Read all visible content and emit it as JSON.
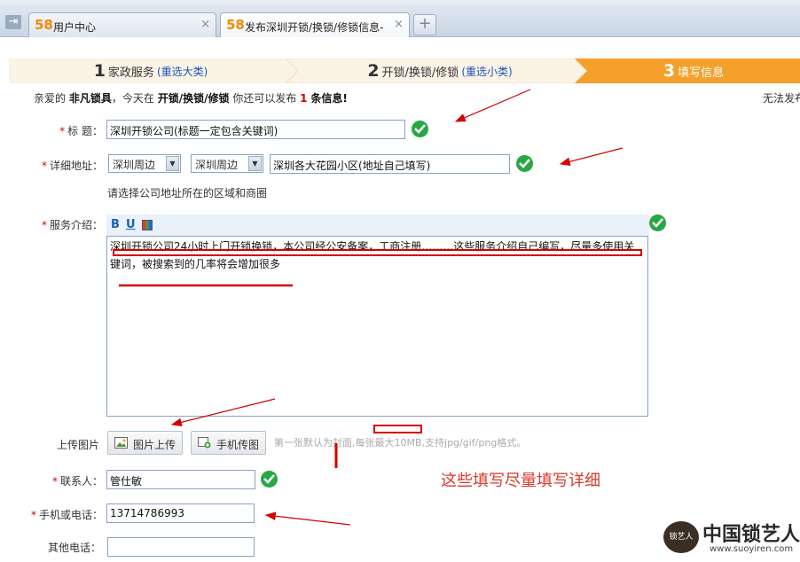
{
  "browser": {
    "tabs": [
      {
        "logo": "58",
        "title": "用户中心",
        "active": false
      },
      {
        "logo": "58",
        "title": "发布深圳开锁/换锁/修锁信息-",
        "active": true
      }
    ],
    "new_tab": "+",
    "close": "×"
  },
  "steps": [
    {
      "number": "1",
      "label": "家政服务",
      "link": "(重选大类)"
    },
    {
      "number": "2",
      "label": "开锁/换锁/修锁",
      "link": "(重选小类)"
    },
    {
      "number": "3",
      "label": "填写信息",
      "link": ""
    }
  ],
  "intro": {
    "prefix": "亲爱的",
    "user": "非凡锁具",
    "middle": "，今天在",
    "category": "开锁/换锁/修锁",
    "suffix_a": "你还可以发布",
    "count": "1",
    "suffix_b": "条信息!",
    "right": "无法发布"
  },
  "form": {
    "required_mark": "*",
    "title": {
      "label": "标  题：",
      "value": "深圳开锁公司(标题一定包含关键词)"
    },
    "address": {
      "label": "详细地址：",
      "select1": "深圳周边",
      "select2": "深圳周边",
      "value": "深圳各大花园小区(地址自己填写)",
      "hint": "请选择公司地址所在的区域和商圈"
    },
    "service": {
      "label": "服务介绍：",
      "toolbar": {
        "bold": "B",
        "underline": "U"
      },
      "content": "深圳开锁公司24小时上门开锁换锁，本公司经公安备案，工商注册………这些服务介绍自己编写，尽量多使用关键词，被搜索到的几率将会增加很多"
    },
    "upload": {
      "label": "上传图片",
      "upload_button": "图片上传",
      "phone_button": "手机传图",
      "hint": "第一张默认为封面,每张最大10MB,支持jpg/gif/png格式。"
    },
    "contact": {
      "label": "联系人：",
      "value": "管仕敏"
    },
    "phone": {
      "label": "手机或电话：",
      "value": "13714786993"
    },
    "other_phone": {
      "label": "其他电话：",
      "value": ""
    }
  },
  "annotation": "这些填写尽量填写详细",
  "watermark": {
    "seal": "锁艺人",
    "title": "中国锁艺人",
    "url": "www.suoyiren.com"
  },
  "colors": {
    "accent_orange": "#f5a02a",
    "step_bg": "#fbf3e6",
    "link_blue": "#1a55b8",
    "required_red": "#d40000",
    "ok_green": "#28a745",
    "annotation_red": "#d93a2b"
  }
}
